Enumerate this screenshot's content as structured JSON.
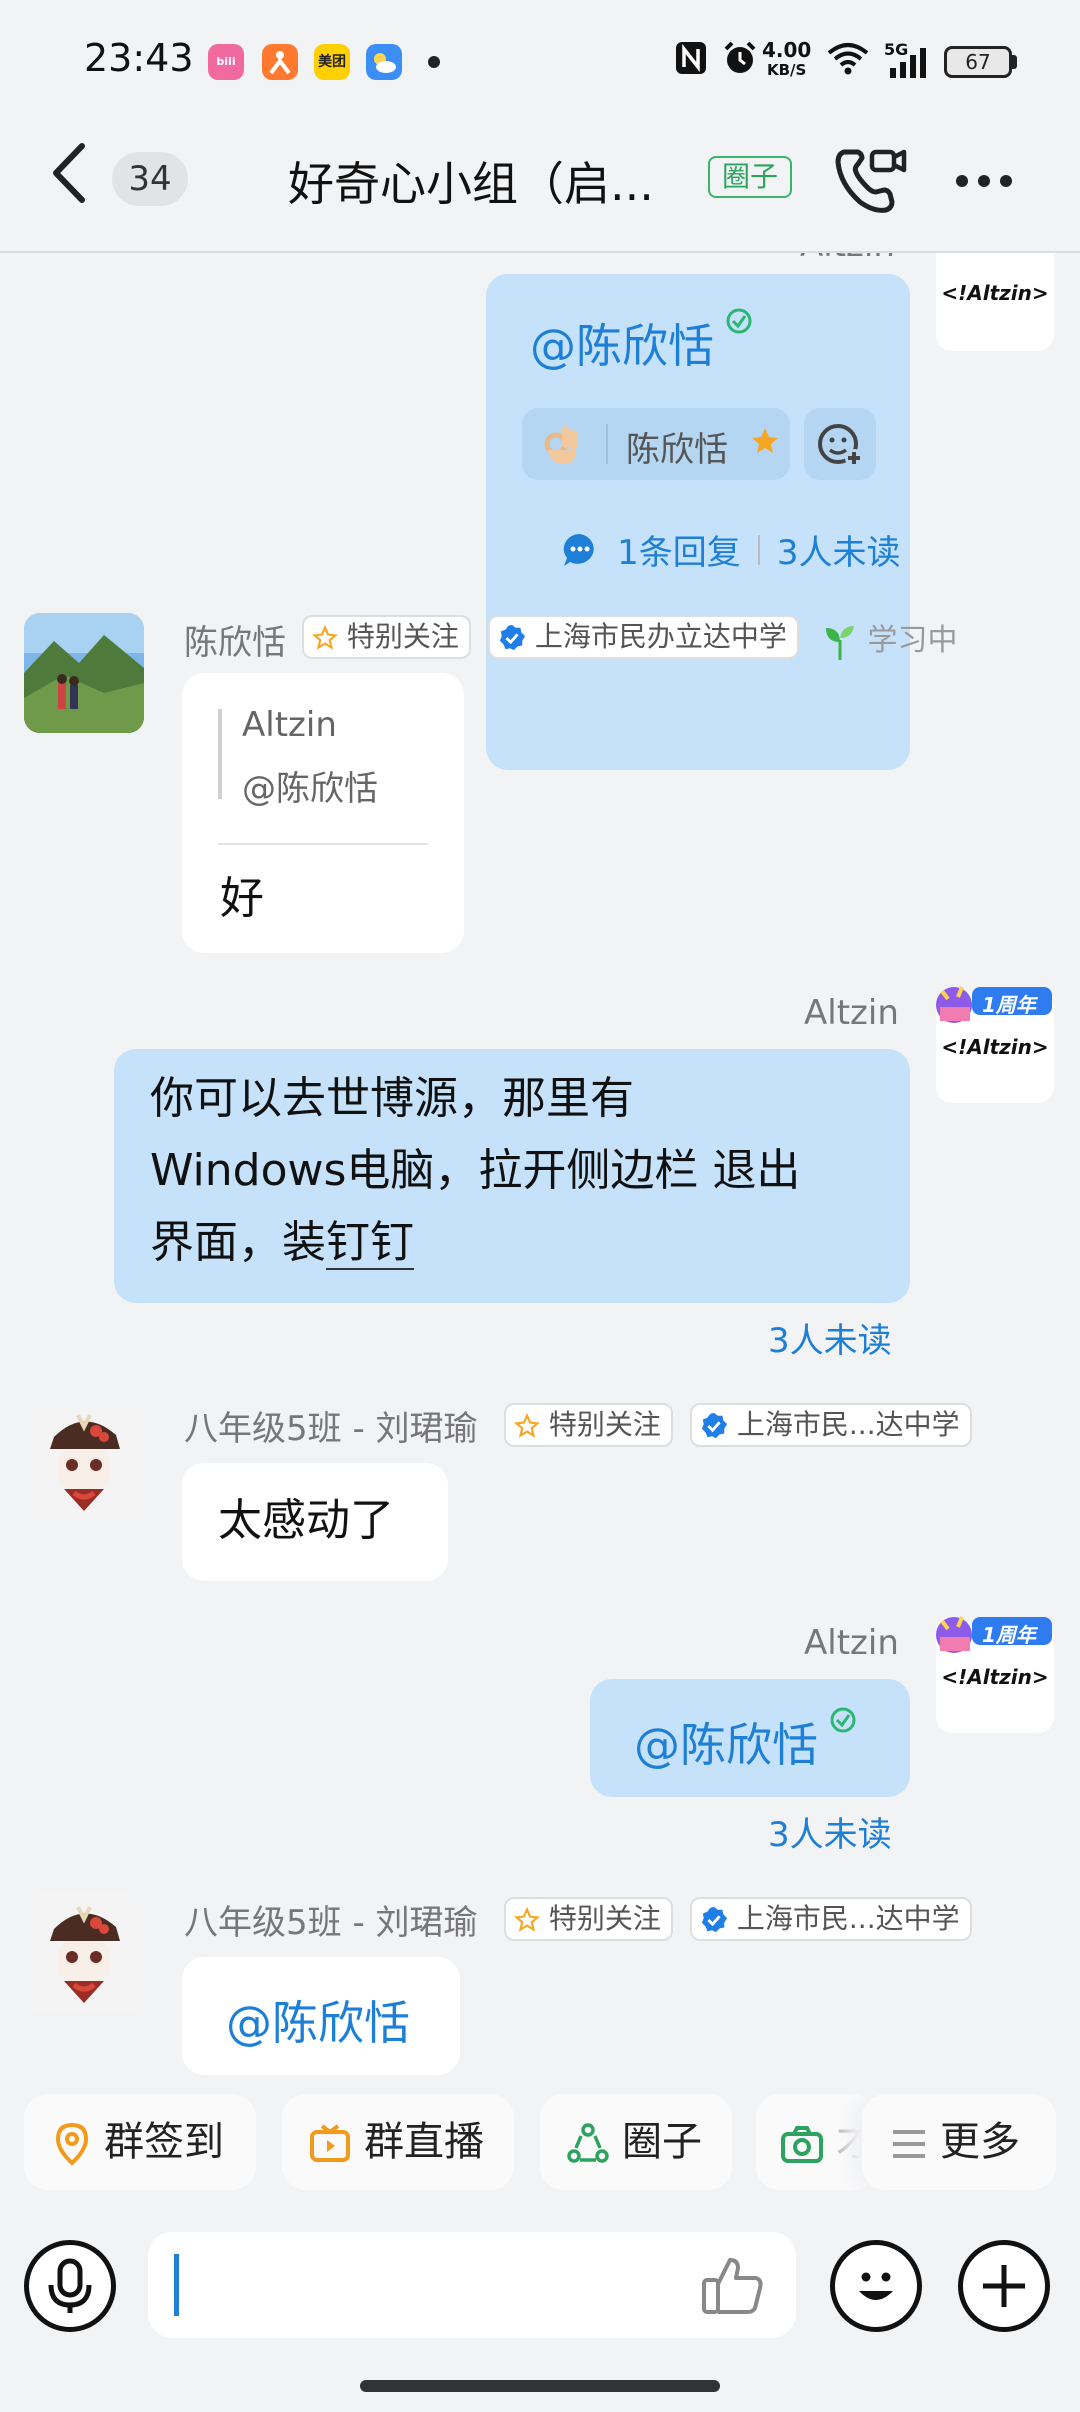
{
  "status_bar": {
    "time": "23:43",
    "apps": [
      "bilibili-icon",
      "taobao-icon",
      "meituan-icon",
      "weather-icon"
    ],
    "meituan_label": "美团",
    "net_speed_value": "4.00",
    "net_speed_unit": "KB/S",
    "signal_label": "5G",
    "battery": "67"
  },
  "header": {
    "unread_count": "34",
    "title": "好奇心小组（启...",
    "tag": "圈子"
  },
  "messages": [
    {
      "sender": "Altzin",
      "mention": "@陈欣恬",
      "reaction_user": "陈欣恬",
      "reply_count": "1条回复",
      "unread": "3人未读",
      "avatar_text": "<!Altzin>"
    },
    {
      "sender": "陈欣恬",
      "pill_follow": "特别关注",
      "pill_school": "上海市民办立达中学",
      "pill_status": "学习中",
      "quote_name": "Altzin",
      "quote_text": "@陈欣恬",
      "text": "好"
    },
    {
      "sender": "Altzin",
      "anniversary": "1周年",
      "avatar_text": "<!Altzin>",
      "line1": "你可以去世博源，那里有",
      "line2": "Windows电脑，拉开侧边栏 退出",
      "line3_a": "界面，装",
      "line3_b": "钉钉",
      "unread": "3人未读"
    },
    {
      "sender": "八年级5班 - 刘珺瑜",
      "pill_follow": "特别关注",
      "pill_school": "上海市民...达中学",
      "text": "太感动了"
    },
    {
      "sender": "Altzin",
      "anniversary": "1周年",
      "avatar_text": "<!Altzin>",
      "mention": "@陈欣恬",
      "unread": "3人未读"
    },
    {
      "sender": "八年级5班 - 刘珺瑜",
      "pill_follow": "特别关注",
      "pill_school": "上海市民...达中学",
      "mention": "@陈欣恬"
    }
  ],
  "quick_bar": {
    "checkin": "群签到",
    "live": "群直播",
    "circle": "圈子",
    "camera_partial": "才",
    "more": "更多"
  },
  "colors": {
    "accent": "#1e7fd6",
    "bubble_self": "#c6e2fb",
    "background": "#f2f3f5",
    "circle_green": "#2ea35f",
    "quick_orange": "#f29a1c"
  }
}
